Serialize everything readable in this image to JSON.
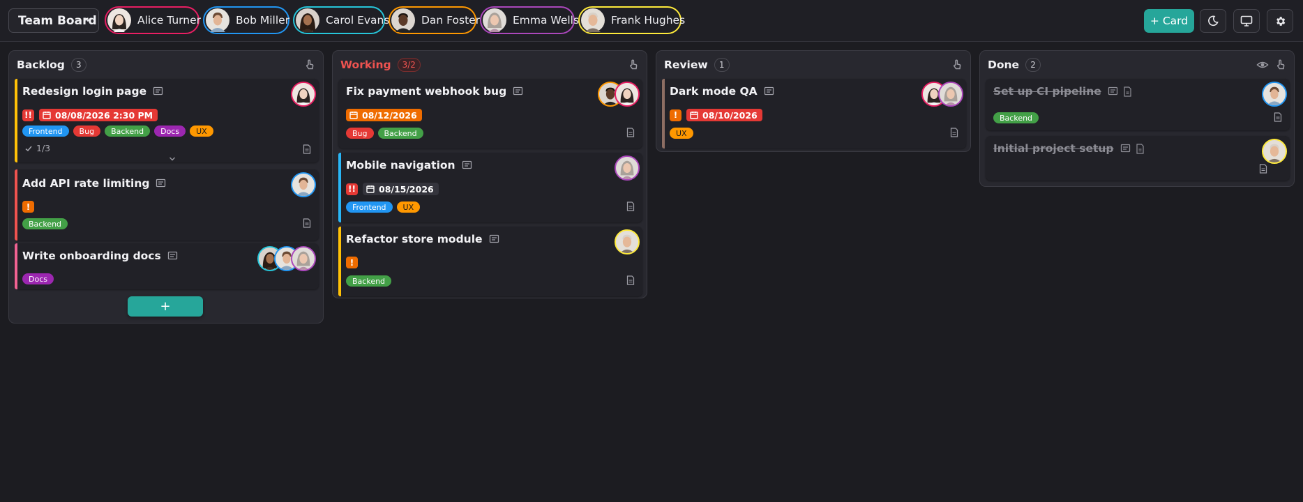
{
  "board": {
    "title": "Team Board"
  },
  "members": [
    {
      "name": "Alice Turner",
      "color": "#e91e63"
    },
    {
      "name": "Bob Miller",
      "color": "#2196f3"
    },
    {
      "name": "Carol Evans",
      "color": "#26c6da"
    },
    {
      "name": "Dan Foster",
      "color": "#ff9800"
    },
    {
      "name": "Emma Wells",
      "color": "#ab47bc"
    },
    {
      "name": "Frank Hughes",
      "color": "#ffeb3b"
    }
  ],
  "toolbar": {
    "add_card_label": "+ Card",
    "theme_icon": "moon-icon",
    "display_icon": "monitor-icon",
    "settings_icon": "gear-icon"
  },
  "columns": [
    {
      "title": "Backlog",
      "title_color": "#f2f2f5",
      "count": "3",
      "icons": [
        "touch-icon"
      ],
      "add_label": "+",
      "cards": [
        {
          "title": "Redesign login page",
          "bar": "#ffc107",
          "priority": "!!",
          "priority_color": "#e53935",
          "due": "08/08/2026 2:30 PM",
          "due_color": "#e53935",
          "tags": [
            {
              "label": "Frontend",
              "color": "#2196f3"
            },
            {
              "label": "Bug",
              "color": "#e53935"
            },
            {
              "label": "Backend",
              "color": "#43a047"
            },
            {
              "label": "Docs",
              "color": "#9c27b0"
            },
            {
              "label": "UX",
              "color": "#ff9800"
            }
          ],
          "checklist": "1/3",
          "assignees": [
            "Alice Turner"
          ]
        },
        {
          "title": "Add API rate limiting",
          "bar": "#ef5350",
          "priority": "!",
          "priority_color": "#ef6c00",
          "tags": [
            {
              "label": "Backend",
              "color": "#43a047"
            }
          ],
          "assignees": [
            "Bob Miller"
          ]
        },
        {
          "title": "Write onboarding docs",
          "bar": "#f06292",
          "tags": [
            {
              "label": "Docs",
              "color": "#9c27b0"
            }
          ],
          "assignees": [
            "Carol Evans",
            "Bob Miller",
            "Emma Wells"
          ]
        }
      ]
    },
    {
      "title": "Working",
      "title_color": "#ef5350",
      "count": "3/2",
      "icons": [
        "touch-icon"
      ],
      "cards": [
        {
          "title": "Fix payment webhook bug",
          "bar": "",
          "due": "08/12/2026",
          "due_color": "#ef6c00",
          "tags": [
            {
              "label": "Bug",
              "color": "#e53935"
            },
            {
              "label": "Backend",
              "color": "#43a047"
            }
          ],
          "assignees": [
            "Dan Foster",
            "Alice Turner"
          ]
        },
        {
          "title": "Mobile navigation",
          "bar": "#29b6f6",
          "priority": "!!",
          "priority_color": "#e53935",
          "due": "08/15/2026",
          "due_color": "#34343c",
          "tags": [
            {
              "label": "Frontend",
              "color": "#2196f3"
            },
            {
              "label": "UX",
              "color": "#ff9800"
            }
          ],
          "assignees": [
            "Emma Wells"
          ]
        },
        {
          "title": "Refactor store module",
          "bar": "#ffc107",
          "priority": "!",
          "priority_color": "#ef6c00",
          "tags": [
            {
              "label": "Backend",
              "color": "#43a047"
            }
          ],
          "assignees": [
            "Frank Hughes"
          ]
        }
      ]
    },
    {
      "title": "Review",
      "title_color": "#f2f2f5",
      "count": "1",
      "icons": [
        "touch-icon"
      ],
      "cards": [
        {
          "title": "Dark mode QA",
          "bar": "#8d6e63",
          "priority": "!",
          "priority_color": "#ef6c00",
          "due": "08/10/2026",
          "due_color": "#e53935",
          "tags": [
            {
              "label": "UX",
              "color": "#ff9800"
            }
          ],
          "assignees": [
            "Alice Turner",
            "Emma Wells"
          ]
        }
      ]
    },
    {
      "title": "Done",
      "title_color": "#f2f2f5",
      "count": "2",
      "icons": [
        "eye-icon",
        "touch-icon"
      ],
      "cards": [
        {
          "title": "Set up CI pipeline",
          "done": true,
          "bar": "",
          "tags": [
            {
              "label": "Backend",
              "color": "#43a047"
            }
          ],
          "assignees": [
            "Bob Miller"
          ]
        },
        {
          "title": "Initial project setup",
          "done": true,
          "bar": "",
          "tags": [],
          "assignees": [
            "Frank Hughes"
          ]
        }
      ]
    }
  ]
}
